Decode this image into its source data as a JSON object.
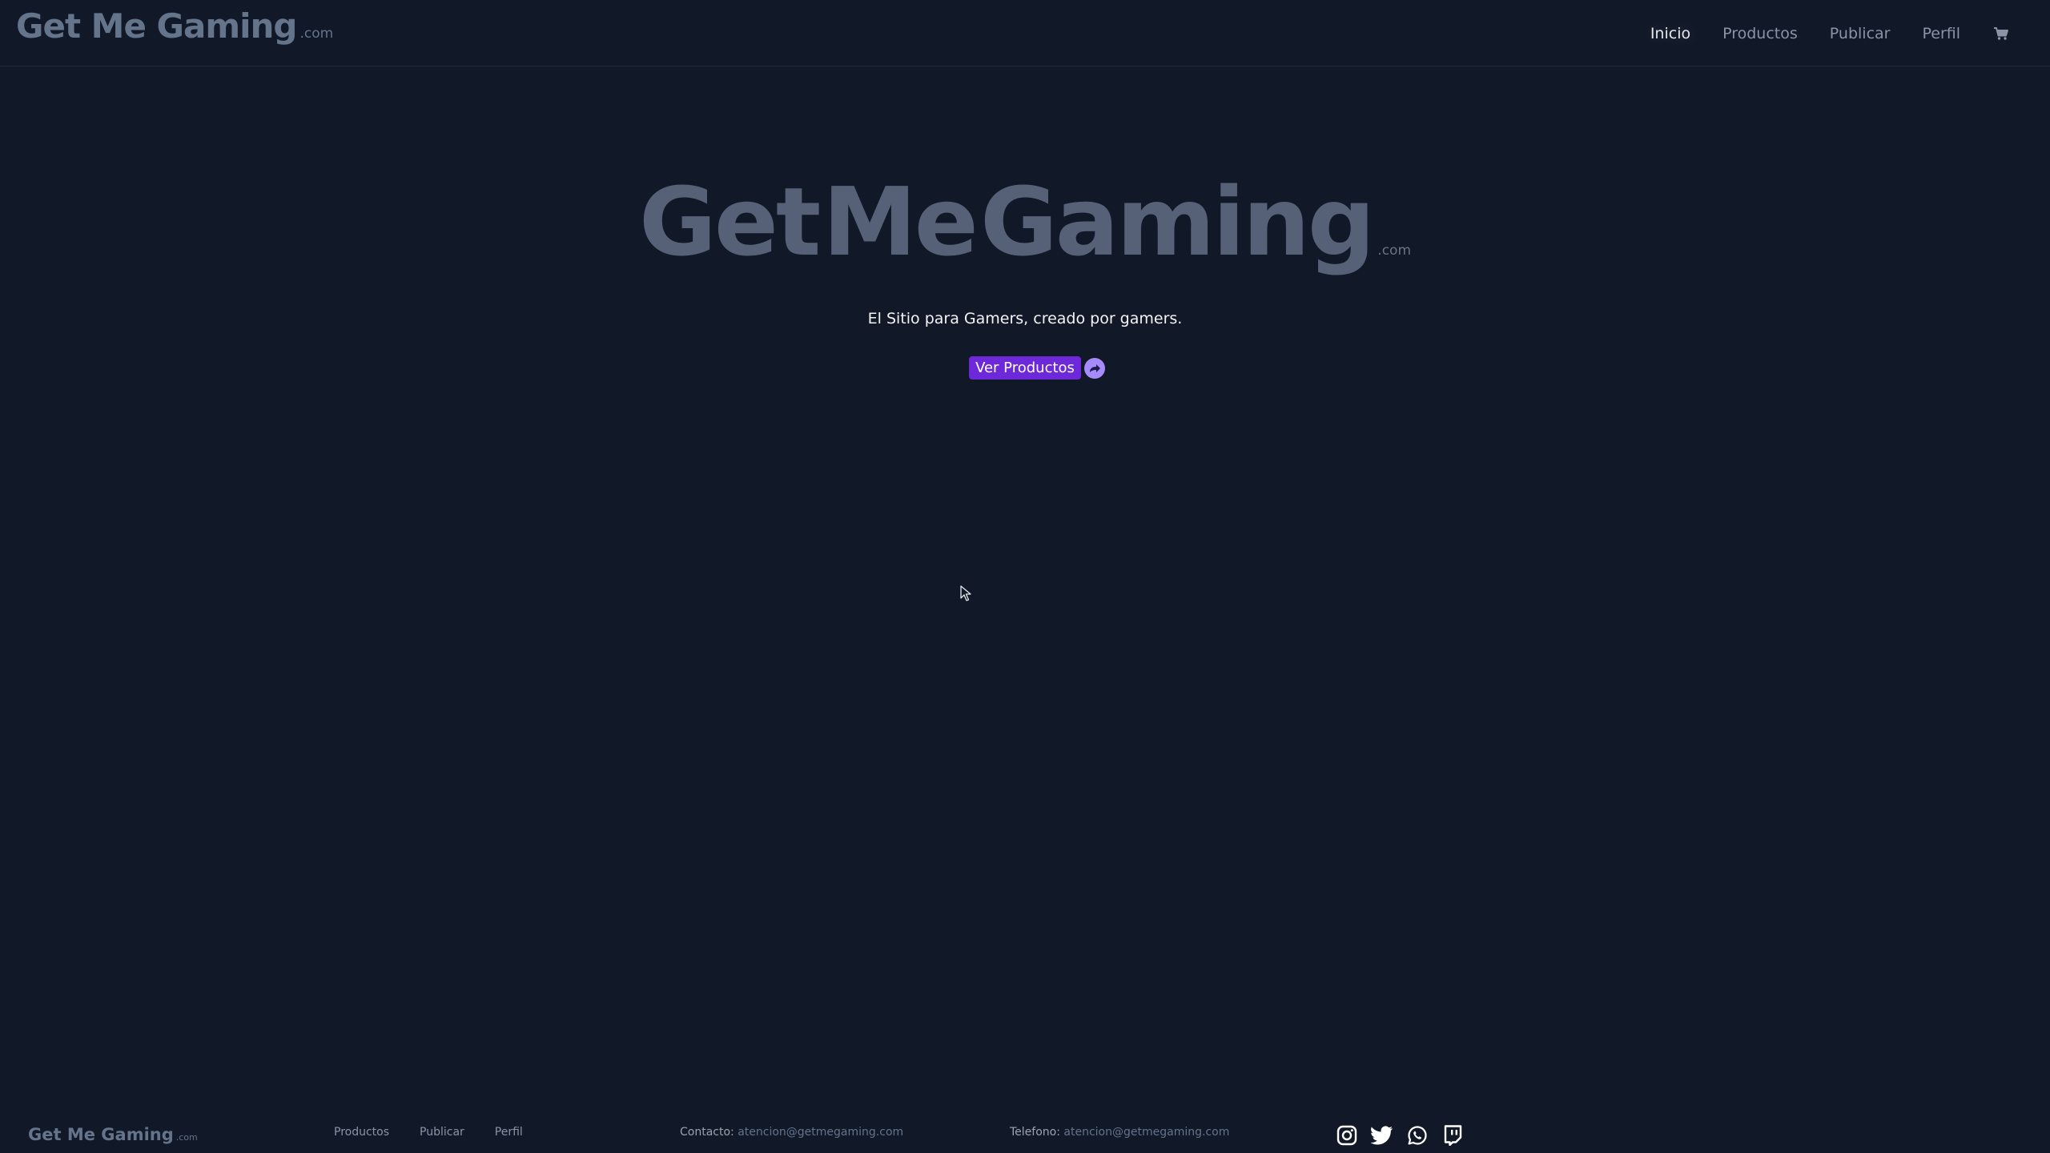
{
  "header": {
    "brand": {
      "name": "Get Me Gaming",
      "suffix": ".com"
    },
    "nav": [
      {
        "label": "Inicio",
        "active": true
      },
      {
        "label": "Productos",
        "active": false
      },
      {
        "label": "Publicar",
        "active": false
      },
      {
        "label": "Perfil",
        "active": false
      }
    ],
    "cart_icon": "cart-icon"
  },
  "hero": {
    "title_parts": [
      "Get",
      "Me",
      "Gaming"
    ],
    "suffix": ".com",
    "tagline": "El Sitio para Gamers, creado por gamers.",
    "cta_label": "Ver Productos",
    "cta_icon": "arrow-circle-icon"
  },
  "footer": {
    "brand": {
      "name": "Get Me Gaming",
      "suffix": ".com"
    },
    "links": [
      {
        "label": "Productos"
      },
      {
        "label": "Publicar"
      },
      {
        "label": "Perfil"
      }
    ],
    "contact": {
      "label": "Contacto:",
      "value": "atencion@getmegaming.com"
    },
    "phone": {
      "label": "Telefono:",
      "value": "atencion@getmegaming.com"
    },
    "social": [
      "instagram-icon",
      "twitter-icon",
      "whatsapp-icon",
      "twitch-icon"
    ]
  },
  "colors": {
    "background": "#111827",
    "accent": "#6d28d9",
    "accent_light": "#a78bfa",
    "brand_text": "#64748b"
  }
}
